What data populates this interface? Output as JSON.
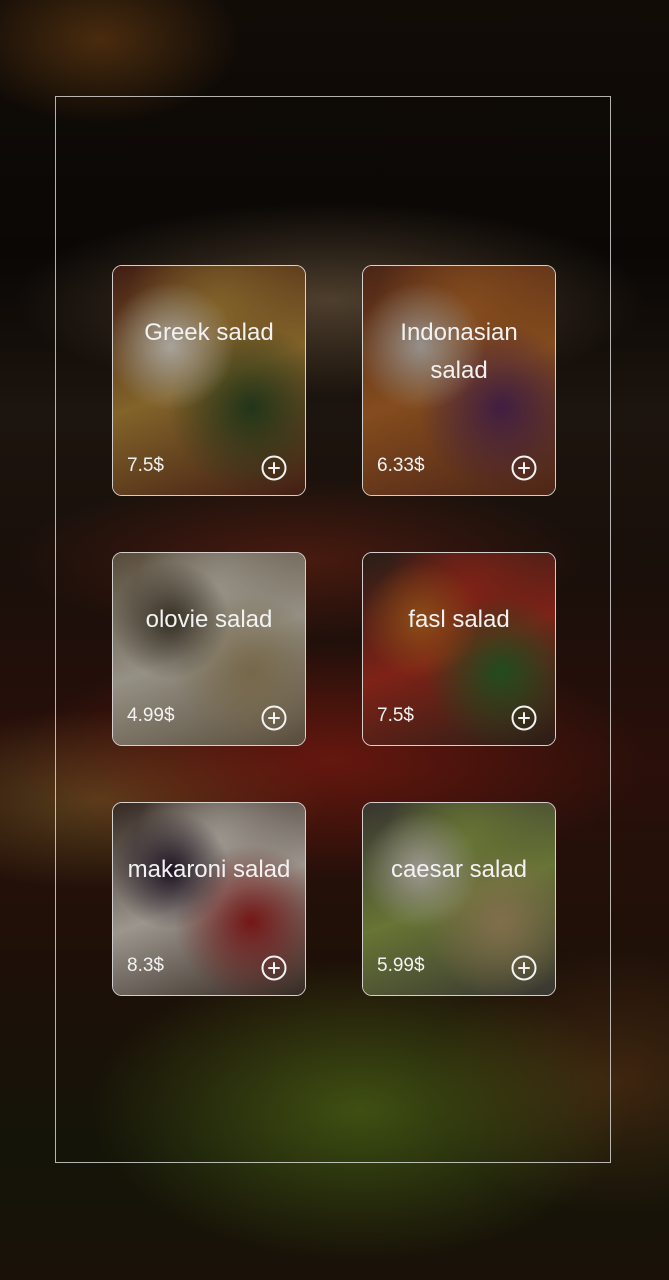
{
  "menu": {
    "items": [
      {
        "name": "Greek salad",
        "price": "7.5$",
        "add_icon": "plus-circle-icon",
        "photo_colors": [
          "#5c2a1c",
          "#b58a3a",
          "#2f4a22",
          "#e8e2d6"
        ]
      },
      {
        "name": "Indonasian\nsalad",
        "price": "6.33$",
        "add_icon": "plus-circle-icon",
        "photo_colors": [
          "#6a3420",
          "#b86a2a",
          "#5a2a5c",
          "#cfc7bf"
        ]
      },
      {
        "name": "olovie salad",
        "price": "4.99$",
        "add_icon": "plus-circle-icon",
        "photo_colors": [
          "#7a6a52",
          "#cfc9b8",
          "#a59066",
          "#4a4030"
        ]
      },
      {
        "name": "fasl salad",
        "price": "7.5$",
        "add_icon": "plus-circle-icon",
        "photo_colors": [
          "#3a2a20",
          "#b03020",
          "#2f6a2a",
          "#c26a20"
        ]
      },
      {
        "name": "makaroni salad",
        "price": "8.3$",
        "add_icon": "plus-circle-icon",
        "photo_colors": [
          "#4a3a30",
          "#d8d0c4",
          "#a02020",
          "#2a1c30"
        ]
      },
      {
        "name": "caesar salad",
        "price": "5.99$",
        "add_icon": "plus-circle-icon",
        "photo_colors": [
          "#4e4a44",
          "#8fa24a",
          "#b49a6a",
          "#d8d2c8"
        ]
      }
    ]
  }
}
